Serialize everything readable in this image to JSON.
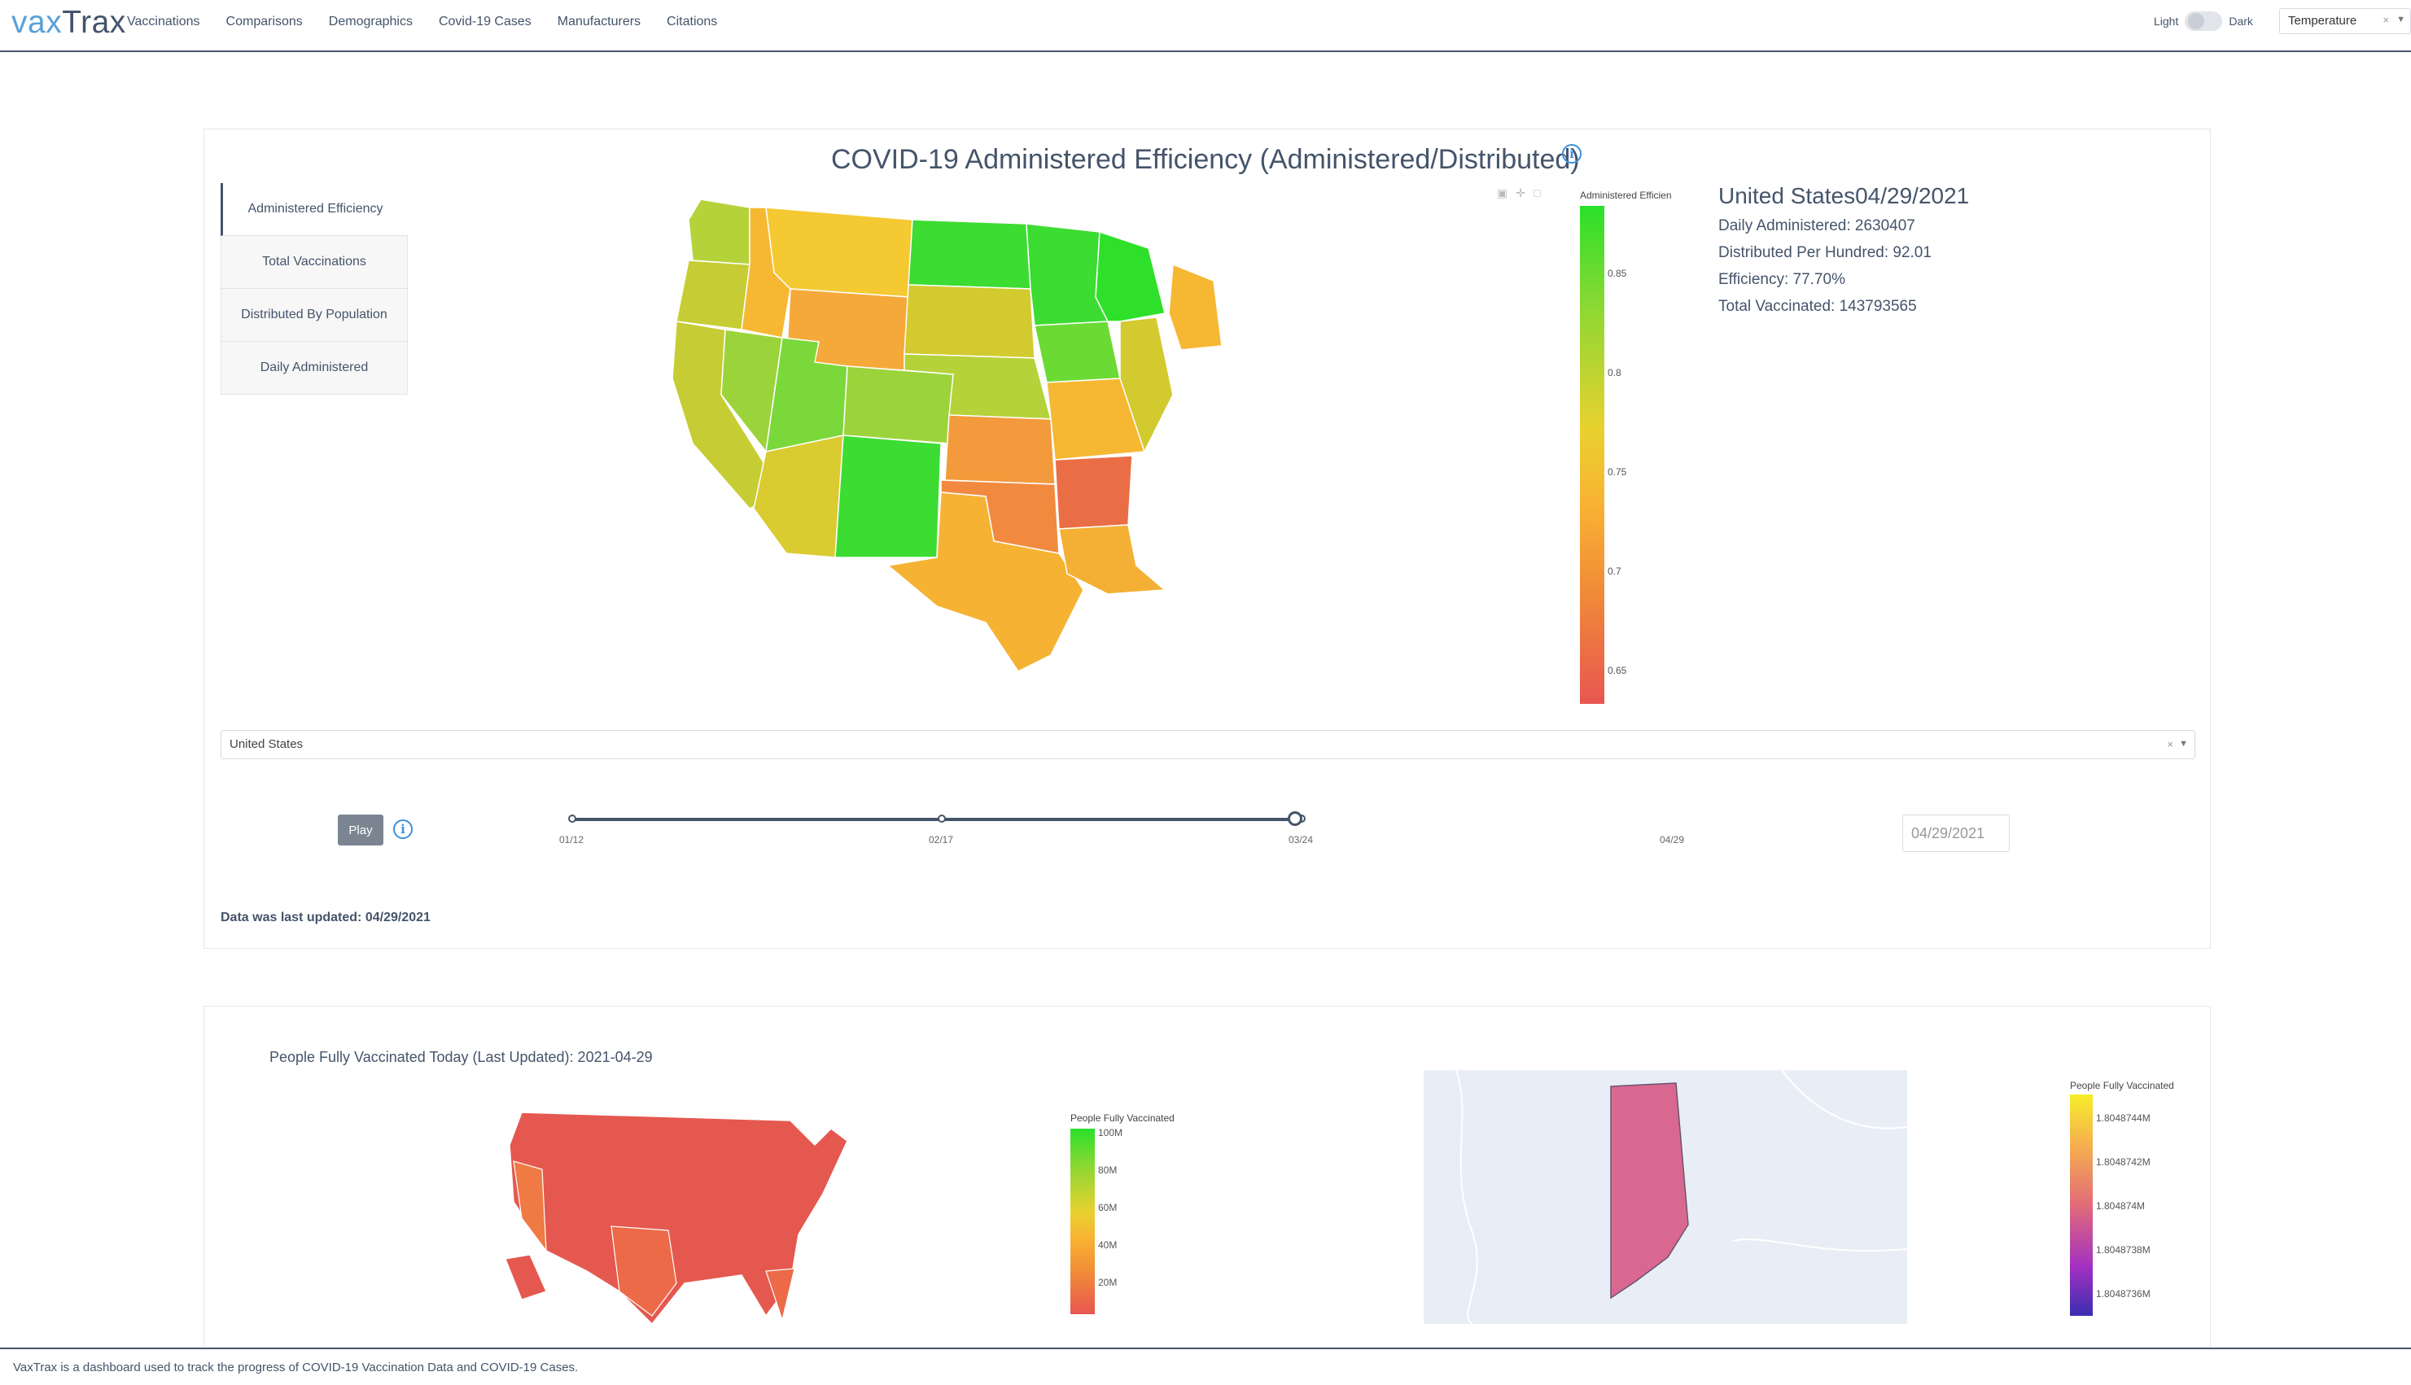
{
  "brand": {
    "part1": "vax",
    "part2": "Trax"
  },
  "nav": {
    "items": [
      "Vaccinations",
      "Comparisons",
      "Demographics",
      "Covid-19 Cases",
      "Manufacturers",
      "Citations"
    ]
  },
  "theme": {
    "light_label": "Light",
    "dark_label": "Dark",
    "scale_value": "Temperature"
  },
  "panel1": {
    "title": "COVID-19 Administered Efficiency (Administered/Distributed)",
    "tabs": [
      "Administered Efficiency",
      "Total Vaccinations",
      "Distributed By Population",
      "Daily Administered"
    ],
    "colorbar_title": "Administered Efficien",
    "colorbar_ticks": [
      "0.85",
      "0.8",
      "0.75",
      "0.7",
      "0.65"
    ],
    "stats": {
      "heading": "United States04/29/2021",
      "daily": "Daily Administered: 2630407",
      "distributed": "Distributed Per Hundred: 92.01",
      "efficiency": "Efficiency: 77.70%",
      "total": "Total Vaccinated: 143793565"
    },
    "country_value": "United States",
    "play_label": "Play",
    "slider_labels": [
      "01/12",
      "02/17",
      "03/24",
      "04/29"
    ],
    "slider_value": 1.0,
    "date_value": "04/29/2021",
    "last_updated": "Data was last updated: 04/29/2021"
  },
  "panel2": {
    "title": "People Fully Vaccinated Today (Last Updated): 2021-04-29",
    "cb1_title": "People Fully Vaccinated",
    "cb1_ticks": [
      "100M",
      "80M",
      "60M",
      "40M",
      "20M"
    ],
    "cb2_title": "People Fully Vaccinated",
    "cb2_ticks": [
      "1.8048744M",
      "1.8048742M",
      "1.804874M",
      "1.8048738M",
      "1.8048736M"
    ]
  },
  "colors": {
    "accent": "#44546a",
    "brand_light": "#5aa0d6",
    "info": "#3d8fdb"
  },
  "footer": {
    "text": "VaxTrax is a dashboard used to track the progress of COVID-19 Vaccination Data and COVID-19 Cases."
  }
}
